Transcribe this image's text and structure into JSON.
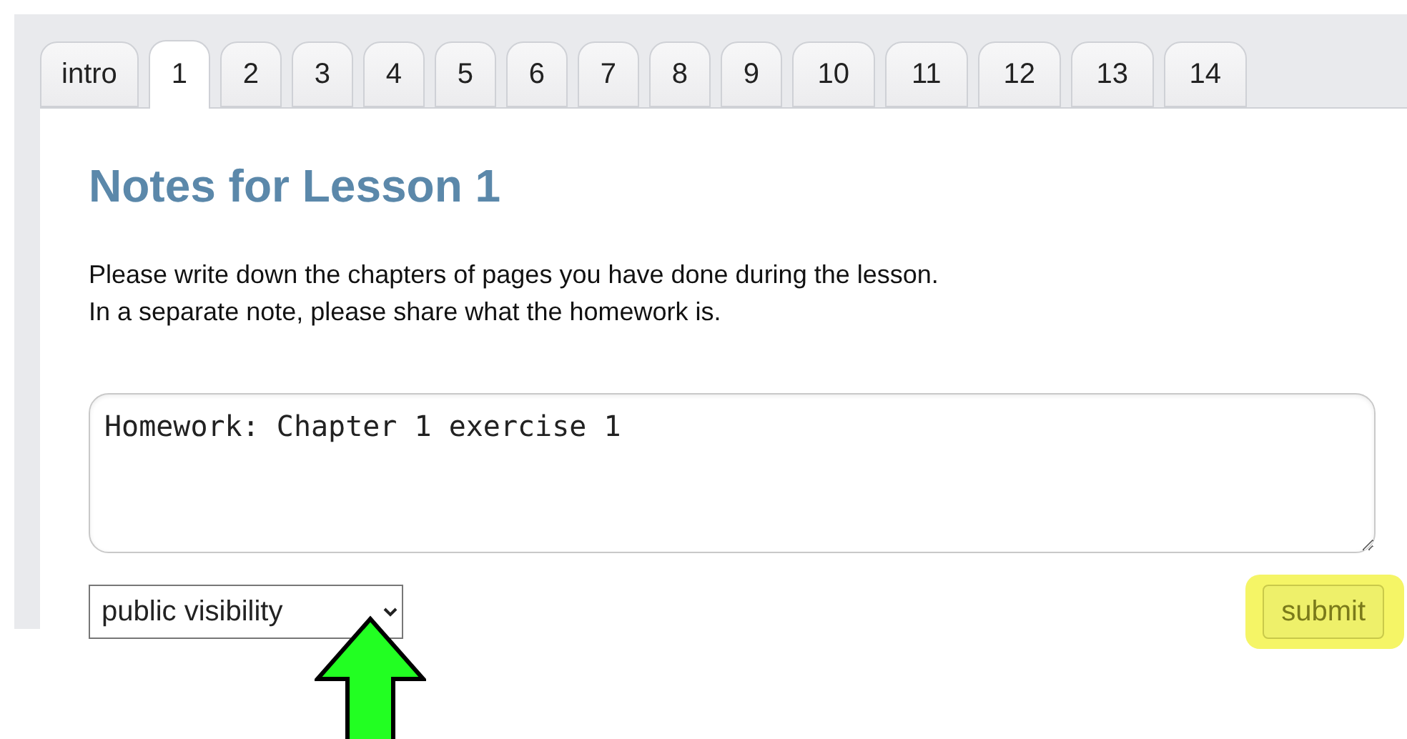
{
  "tabs": [
    {
      "label": "intro",
      "selected": false
    },
    {
      "label": "1",
      "selected": true
    },
    {
      "label": "2",
      "selected": false
    },
    {
      "label": "3",
      "selected": false
    },
    {
      "label": "4",
      "selected": false
    },
    {
      "label": "5",
      "selected": false
    },
    {
      "label": "6",
      "selected": false
    },
    {
      "label": "7",
      "selected": false
    },
    {
      "label": "8",
      "selected": false
    },
    {
      "label": "9",
      "selected": false
    },
    {
      "label": "10",
      "selected": false
    },
    {
      "label": "11",
      "selected": false
    },
    {
      "label": "12",
      "selected": false
    },
    {
      "label": "13",
      "selected": false
    },
    {
      "label": "14",
      "selected": false
    }
  ],
  "heading": "Notes for Lesson 1",
  "instructions": [
    "Please write down the chapters of pages you have done during the lesson.",
    "In a separate note, please share what the homework is."
  ],
  "note": {
    "value": "Homework: Chapter 1 exercise 1"
  },
  "visibility": {
    "value": "public visibility"
  },
  "submit": {
    "label": "submit",
    "highlighted": true
  },
  "annotations": [
    {
      "kind": "arrow"
    }
  ]
}
